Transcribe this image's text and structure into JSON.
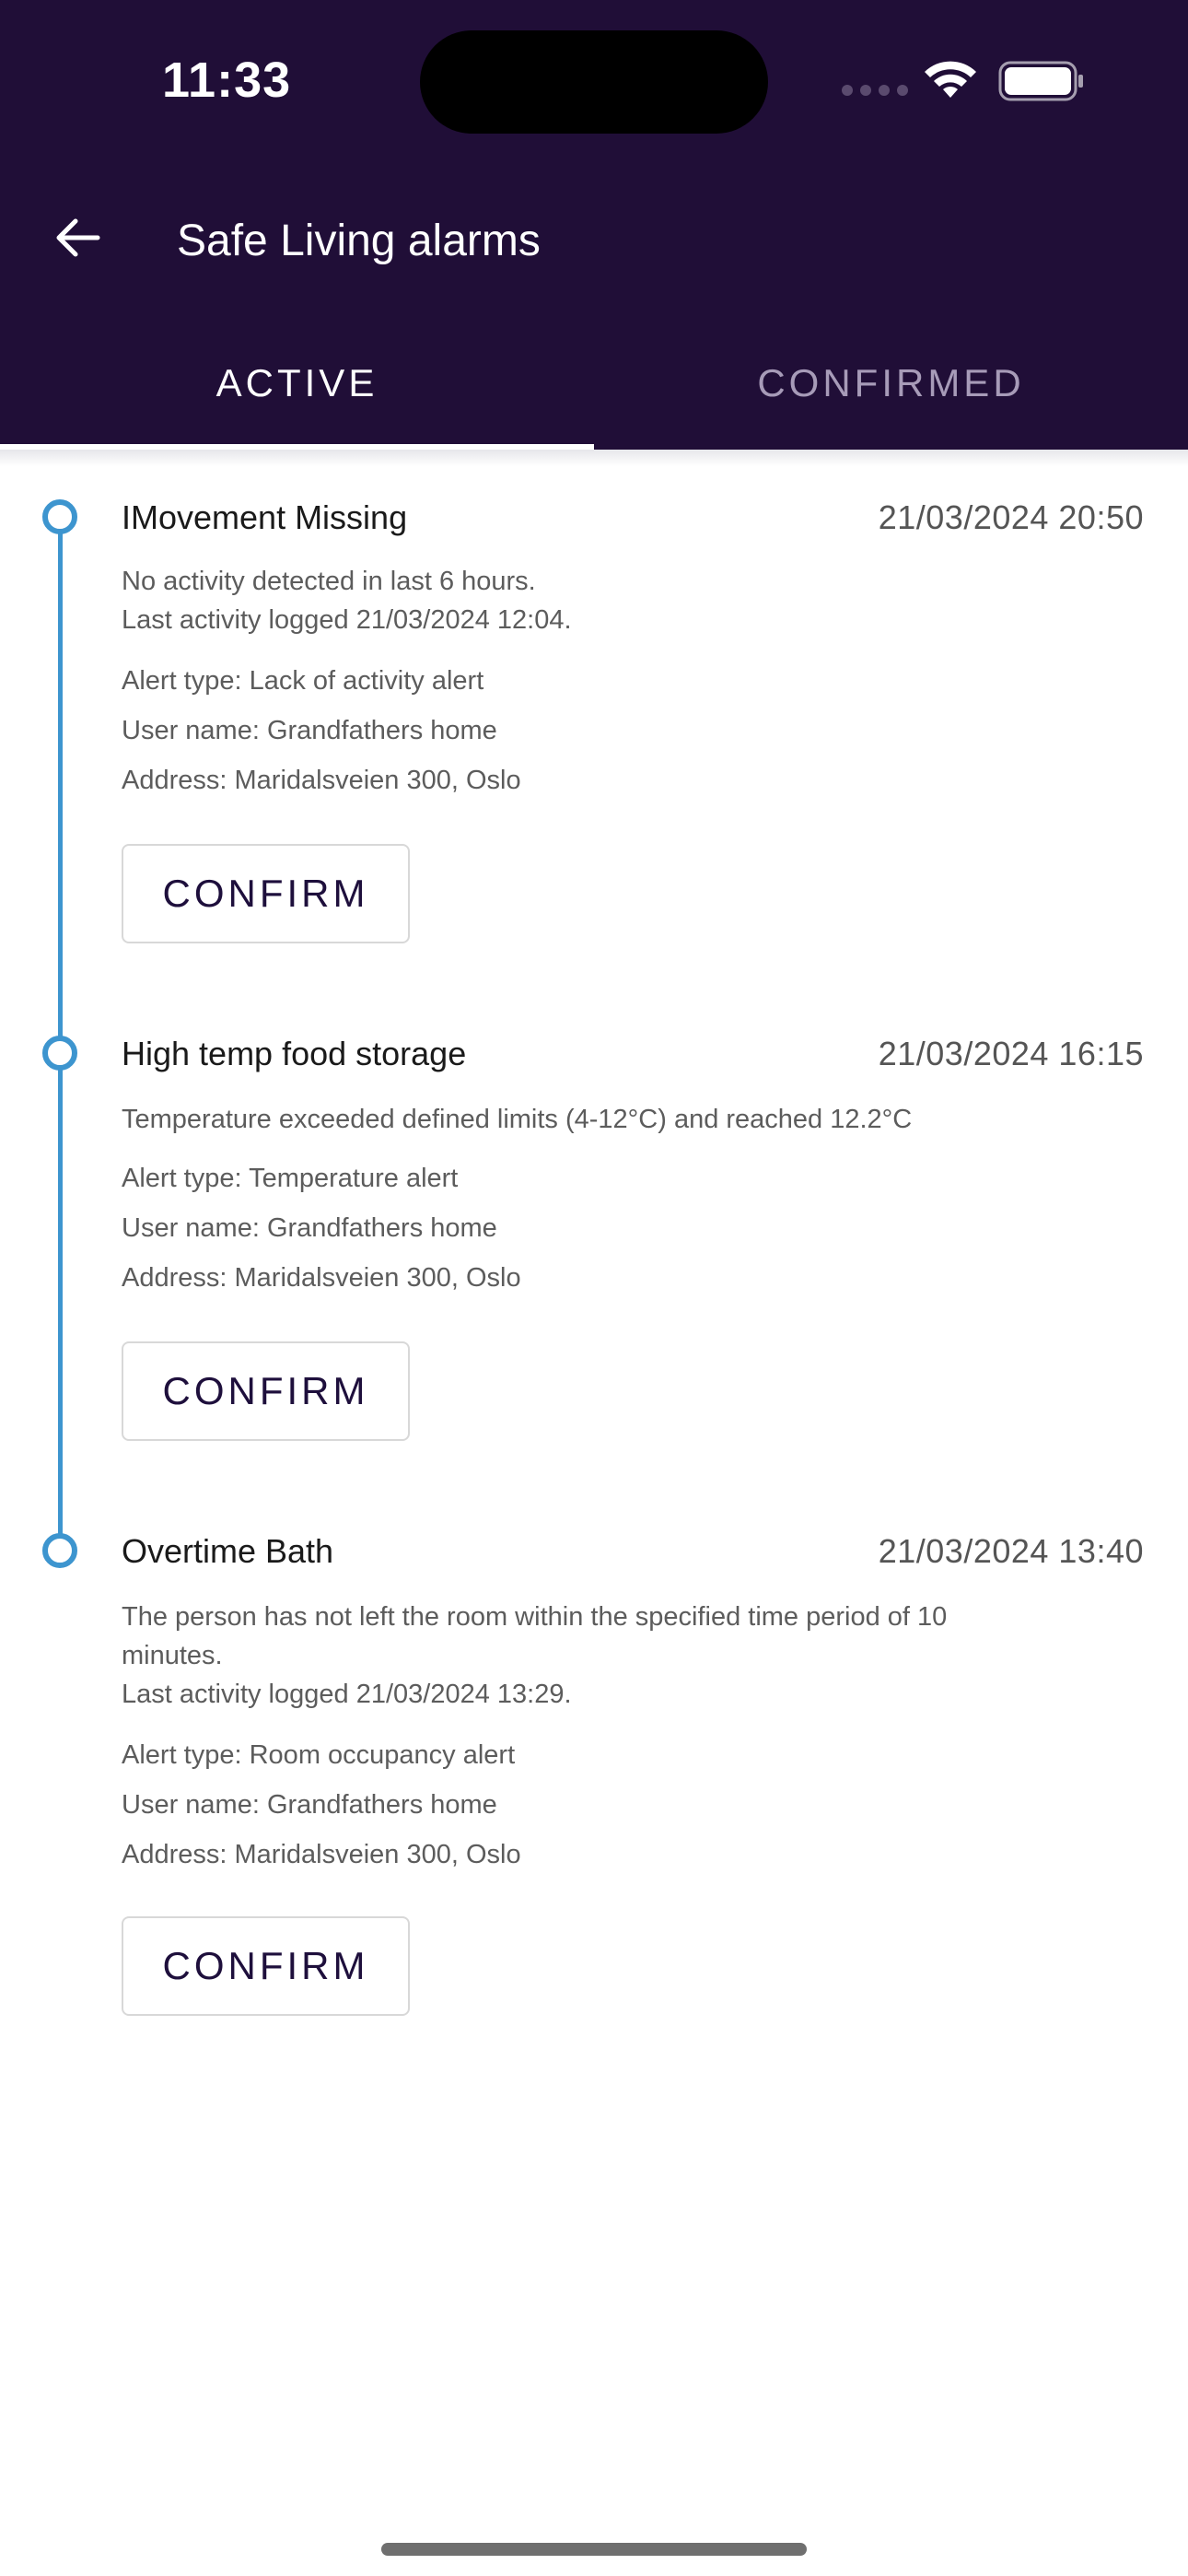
{
  "status_bar": {
    "time": "11:33"
  },
  "header": {
    "back_icon": "arrow-left-icon",
    "title": "Safe Living alarms"
  },
  "tabs": [
    {
      "label": "ACTIVE",
      "active": true
    },
    {
      "label": "CONFIRMED",
      "active": false
    }
  ],
  "colors": {
    "header_bg": "#200e37",
    "timeline": "#3d95cf",
    "button_text": "#1e0f3c"
  },
  "alarms": [
    {
      "title": "IMovement Missing",
      "time": "21/03/2024 20:50",
      "description": [
        "No activity detected in last 6 hours.",
        "Last activity logged 21/03/2024 12:04."
      ],
      "alert_type": "Alert type: Lack of activity alert",
      "user_name": "User name: Grandfathers home",
      "address": "Address: Maridalsveien 300, Oslo",
      "confirm_label": "CONFIRM"
    },
    {
      "title": "High temp food storage",
      "time": "21/03/2024 16:15",
      "description": [
        "Temperature exceeded defined limits (4-12°C) and reached 12.2°C"
      ],
      "alert_type": "Alert type: Temperature alert",
      "user_name": "User name: Grandfathers home",
      "address": "Address: Maridalsveien 300, Oslo",
      "confirm_label": "CONFIRM"
    },
    {
      "title": "Overtime Bath",
      "time": "21/03/2024 13:40",
      "description": [
        "The person has not left the room within the specified time period of 10",
        "minutes.",
        "Last activity logged 21/03/2024 13:29."
      ],
      "alert_type": "Alert type: Room occupancy alert",
      "user_name": "User name: Grandfathers home",
      "address": "Address: Maridalsveien 300, Oslo",
      "confirm_label": "CONFIRM"
    }
  ]
}
